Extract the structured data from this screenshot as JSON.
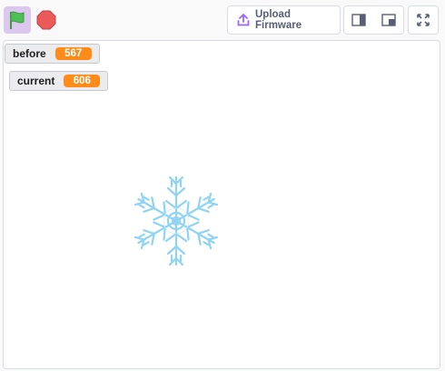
{
  "toolbar": {
    "green_flag_icon": "green-flag-icon",
    "stop_icon": "stop-sign-icon",
    "upload_label": "Upload Firmware",
    "upload_icon": "upload-icon",
    "small_stage_icon": "small-stage-icon",
    "large_stage_icon": "large-stage-icon",
    "fullscreen_icon": "fullscreen-icon"
  },
  "stage": {
    "monitors": [
      {
        "label": "before",
        "value": "567"
      },
      {
        "label": "current",
        "value": "606"
      }
    ],
    "sprite_icon": "snowflake-icon"
  },
  "colors": {
    "accent": "#9966ff",
    "monitor_value": "#ff8c1a",
    "green_flag": "#4cbf56",
    "stop": "#ec5959",
    "snowflake": "#8fd3f5"
  }
}
